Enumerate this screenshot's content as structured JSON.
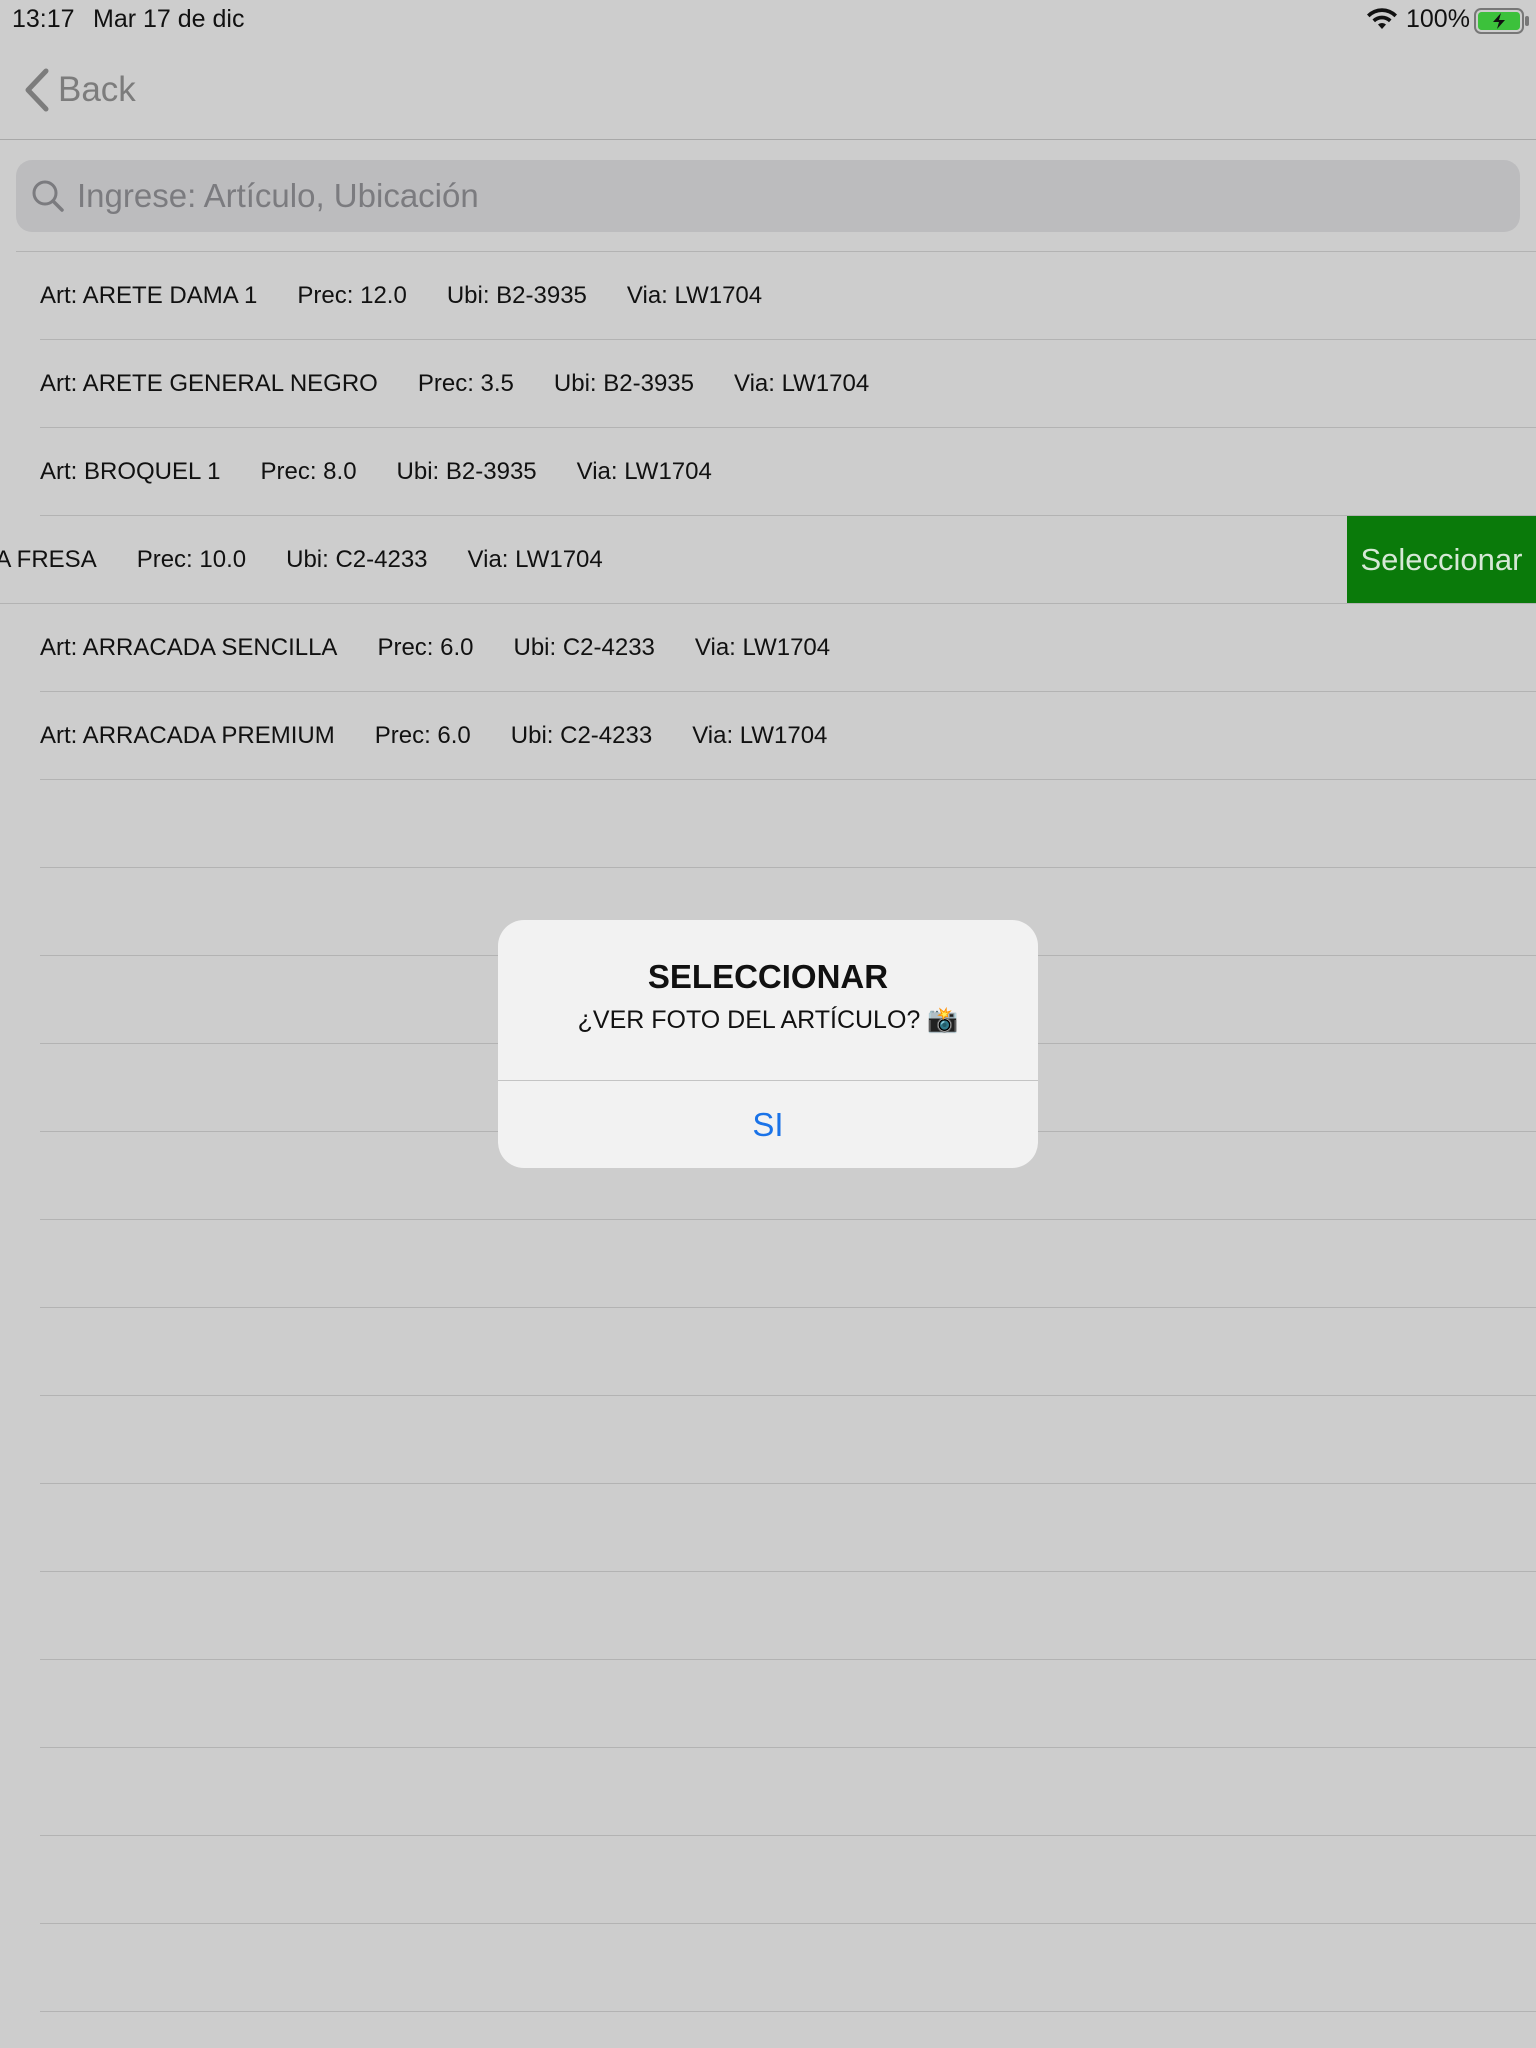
{
  "status_bar": {
    "time": "13:17",
    "date": "Mar 17 de dic",
    "battery_percent": "100%",
    "battery_level": 1.0,
    "battery_color": "#3cc13b"
  },
  "nav": {
    "back_label": "Back"
  },
  "search": {
    "placeholder": "Ingrese: Artículo, Ubicación",
    "value": ""
  },
  "list": {
    "rows": [
      {
        "art": "Art: ARETE DAMA 1",
        "prec": "Prec: 12.0",
        "ubi": "Ubi: B2-3935",
        "via": "Via: LW1704"
      },
      {
        "art": "Art: ARETE GENERAL NEGRO",
        "prec": "Prec: 3.5",
        "ubi": "Ubi: B2-3935",
        "via": "Via: LW1704"
      },
      {
        "art": "Art: BROQUEL 1",
        "prec": "Prec: 8.0",
        "ubi": "Ubi: B2-3935",
        "via": "Via: LW1704"
      },
      {
        "art": "DA FRESA",
        "prec": "Prec: 10.0",
        "ubi": "Ubi: C2-4233",
        "via": "Via: LW1704",
        "swipe_action": "Seleccionar"
      },
      {
        "art": "Art: ARRACADA SENCILLA",
        "prec": "Prec: 6.0",
        "ubi": "Ubi: C2-4233",
        "via": "Via: LW1704"
      },
      {
        "art": "Art: ARRACADA PREMIUM",
        "prec": "Prec: 6.0",
        "ubi": "Ubi: C2-4233",
        "via": "Via: LW1704"
      }
    ],
    "swipe_action_color": "#0a7a0a"
  },
  "alert": {
    "title": "SELECCIONAR",
    "message": "¿VER FOTO DEL ARTÍCULO? 📸",
    "button": "SI",
    "button_color": "#1a73e8"
  }
}
